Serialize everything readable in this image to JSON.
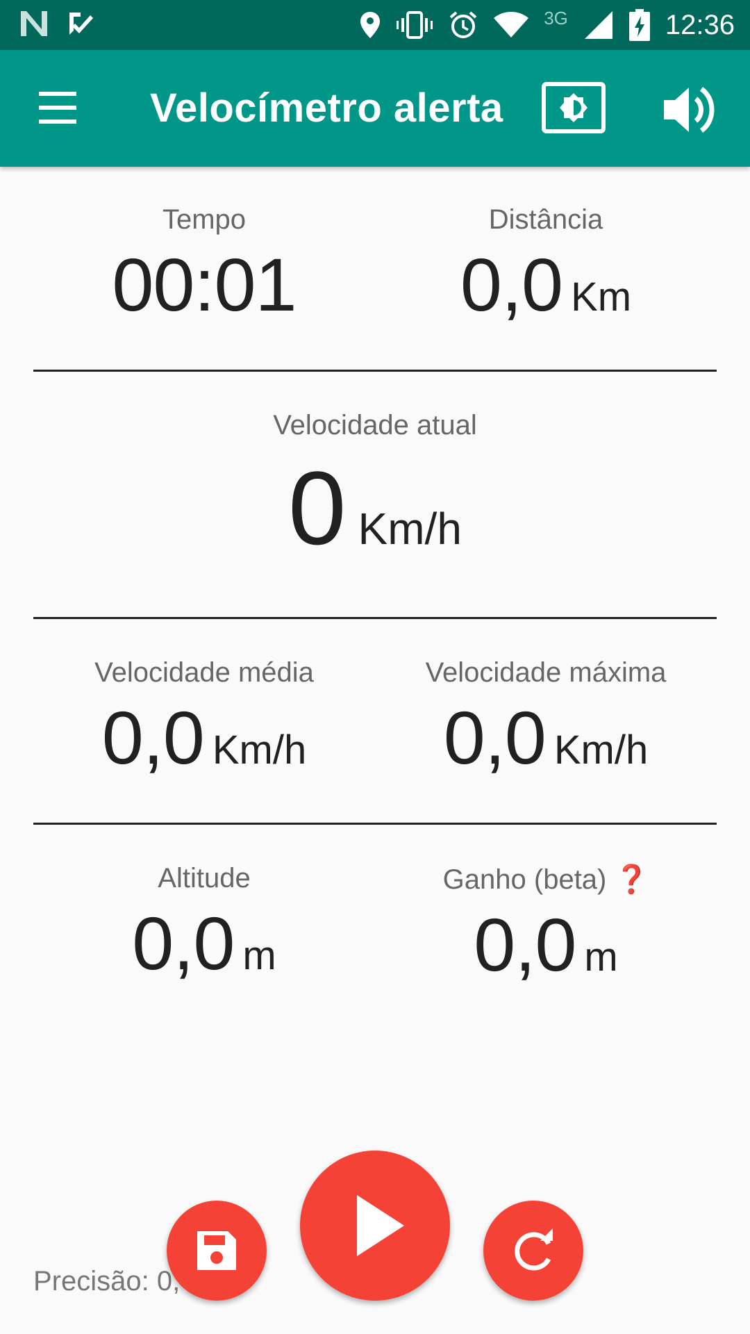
{
  "status_bar": {
    "time": "12:36",
    "network": "3G",
    "icons": [
      "n-logo-icon",
      "checkmark-app-icon",
      "location-pin-icon",
      "vibrate-icon",
      "alarm-icon",
      "wifi-icon",
      "cell-signal-icon",
      "battery-charging-icon"
    ]
  },
  "app_bar": {
    "title": "Velocímetro alerta",
    "icons": [
      "menu-icon",
      "brightness-icon",
      "volume-icon"
    ]
  },
  "stats": {
    "tempo": {
      "label": "Tempo",
      "value": "00:01",
      "unit": ""
    },
    "distancia": {
      "label": "Distância",
      "value": "0,0",
      "unit": "Km"
    },
    "velocidade_atual": {
      "label": "Velocidade atual",
      "value": "0",
      "unit": "Km/h"
    },
    "velocidade_media": {
      "label": "Velocidade média",
      "value": "0,0",
      "unit": "Km/h"
    },
    "velocidade_maxima": {
      "label": "Velocidade máxima",
      "value": "0,0",
      "unit": "Km/h"
    },
    "altitude": {
      "label": "Altitude",
      "value": "0,0",
      "unit": "m"
    },
    "ganho": {
      "label": "Ganho (beta)",
      "value": "0,0",
      "unit": "m",
      "help_glyph": "❓"
    }
  },
  "footer": {
    "precisao": "Precisão: 0,"
  },
  "colors": {
    "status_bar": "#00695c",
    "app_bar": "#009688",
    "fab": "#f44336",
    "background": "#fafafa"
  }
}
